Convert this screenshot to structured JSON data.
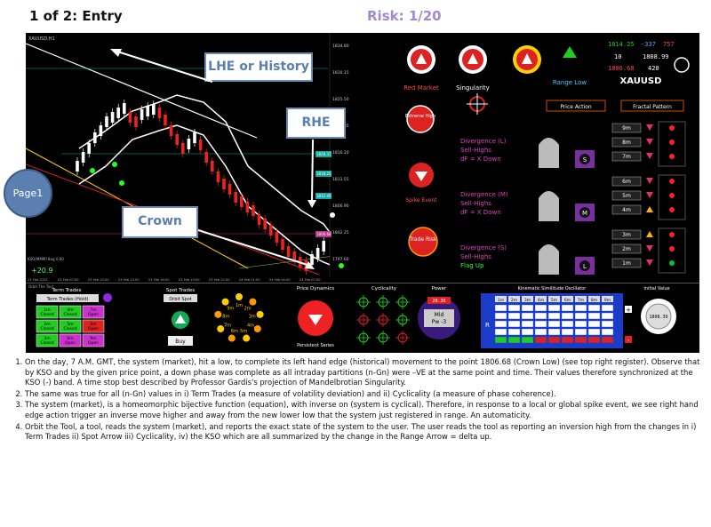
{
  "header": {
    "slide_title": "1 of 2: Entry",
    "risk": "Risk: 1/20"
  },
  "side_nav": {
    "page_label": "Page1"
  },
  "callouts": {
    "lhe": "LHE or History",
    "rhe": "RHE",
    "crown": "Crown"
  },
  "chart": {
    "symbol_header": "XAUUSD,H1",
    "price_labels": [
      "1834.80",
      "1830.15",
      "1825.50",
      "1820.85",
      "1816.20",
      "1811.55",
      "1806.90",
      "1802.25",
      "1797.60"
    ],
    "time_labels": [
      "23 Feb 2023",
      "23 Feb 07:00",
      "23 Feb 10:00",
      "23 Feb 13:00",
      "23 Feb 16:00",
      "23 Feb 19:00",
      "23 Feb 22:00",
      "24 Feb 01:00",
      "24 Feb 04:00",
      "24 Feb 07:00"
    ],
    "level_tags": [
      "1828.37",
      "1818.25",
      "1812.40",
      "1806.68"
    ],
    "change_label": "+20.9",
    "corner_label": "KSO(MMM) 8ug 0.00"
  },
  "right_panel": {
    "stats": {
      "v1": "1814.25",
      "v2": "-337",
      "v3": "757",
      "v4": "10",
      "v5": "1808.99",
      "v6": "1806.68",
      "v7": "420"
    },
    "symbol": "XAUUSD",
    "badges": {
      "red_market": "Red Market",
      "singularity": "Singularity",
      "range_low": "Range Low",
      "extreme_high": "Extreme High",
      "spike_event": "Spike Event",
      "trade_risk": "Trade Risk"
    },
    "section_price_action": "Price Action",
    "section_fractal": "Fractal Pattern",
    "divergences": [
      {
        "title": "Divergence (L)",
        "line2": "Sell-Highs",
        "line3": "dF = X Down",
        "letter": "S",
        "tfs": [
          "9m",
          "8m",
          "7m"
        ]
      },
      {
        "title": "Divergence (M)",
        "line2": "Sell-Highs",
        "line3": "dF = X Down",
        "letter": "M",
        "tfs": [
          "6m",
          "5m",
          "4m"
        ]
      },
      {
        "title": "Divergence (S)",
        "line2": "Sell-Highs",
        "line3": "Flag Up",
        "letter": "L",
        "tfs": [
          "3m",
          "2m",
          "1m"
        ]
      }
    ],
    "colors": {
      "up": "#ffb000",
      "down": "#e0306a",
      "dot_red": "#ff2020",
      "dot_green": "#00c040"
    }
  },
  "bottom_panel": {
    "orbit_tool": "Orbit The Tool",
    "term_trades": {
      "title": "Term Trades",
      "btn": "Term Trades (Hold)",
      "cells": [
        "1m Closed",
        "4m Closed",
        "7m Open",
        "2m Closed",
        "5m Closed",
        "8m Open",
        "3m Closed",
        "6m Open",
        "9m Open"
      ]
    },
    "spot_trades": {
      "title": "Spot Trades",
      "btn": "Orbit Spot",
      "action": "Buy"
    },
    "cycle_labels": [
      "1m",
      "2m",
      "3m",
      "4m",
      "5m",
      "6m",
      "7m",
      "8m",
      "9m"
    ],
    "price_dynamics": {
      "title": "Price Dynamics",
      "sub": "Persistent Series"
    },
    "cyclicality": {
      "title": "Cyclicality"
    },
    "power": {
      "title": "Power",
      "value": "20.36",
      "label1": "Mid",
      "label2": "Pw -3"
    },
    "oscillator": {
      "title": "Kinematic Similitude Oscillator",
      "cols": [
        "1m",
        "2m",
        "3m",
        "4m",
        "5m",
        "6m",
        "7m",
        "8m",
        "9m"
      ],
      "r": "R",
      "plus": "+",
      "minus": "-"
    },
    "initial_value": {
      "title": "Initial Value",
      "value": "1808.39"
    }
  },
  "notes": [
    "On the day, 7 A.M. GMT, the system (market), hit a low, to complete its left hand edge (historical) movement to the point 1806.68 (Crown Low) (see top right register). Observe that by KSO and by the given price point, a down phase was complete as all intraday partitions (n-Gn) were –VE at the same point and time. Their values therefore synchronized at the KSO (-) band. A time stop best described by Professor Gardis's projection of Mandelbrotian Singularity.",
    "The same was true for all (n-Gn) values in  i) Term Trades (a measure of volatility deviation) and ii) Cyclicality (a measure of phase coherence).",
    "The system (market), is a homeomorphic bijective function (equation), with inverse on (system is cyclical). Therefore, in response to a local or global spike event, we see right hand edge action trigger an inverse move higher and away from  the new lower low that the system just registered in range. An automaticity.",
    "Orbit the Tool, a tool, reads the system (market), and reports the exact state of the system to the user. The user reads the tool as reporting an inversion high from the changes in i) Term Trades ii) Spot Arrow iii) Cyclicality, iv) the KSO which are all summarized by the change in the Range Arrow = delta up."
  ]
}
